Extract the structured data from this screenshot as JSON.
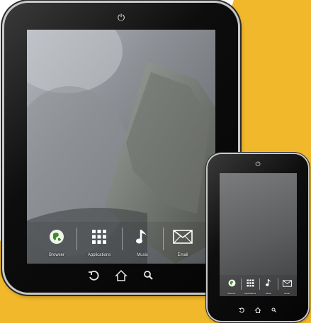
{
  "colors": {
    "accent": "#f0b82a",
    "device": "#0b0b0b",
    "label": "#f2f2f2"
  },
  "tablet": {
    "power_icon": "power-icon",
    "dock": [
      {
        "label": "Browser",
        "icon": "globe-icon"
      },
      {
        "label": "Applications",
        "icon": "grid-icon"
      },
      {
        "label": "Music",
        "icon": "music-note-icon"
      },
      {
        "label": "Email",
        "icon": "envelope-icon"
      }
    ],
    "nav": [
      "back-icon",
      "home-icon",
      "search-icon"
    ]
  },
  "phone": {
    "power_icon": "power-icon",
    "dock": [
      {
        "label": "Browser",
        "icon": "globe-icon"
      },
      {
        "label": "Applications",
        "icon": "grid-icon"
      },
      {
        "label": "Music",
        "icon": "music-note-icon"
      },
      {
        "label": "Email",
        "icon": "envelope-icon"
      }
    ],
    "nav": [
      "back-icon",
      "home-icon",
      "search-icon"
    ]
  }
}
